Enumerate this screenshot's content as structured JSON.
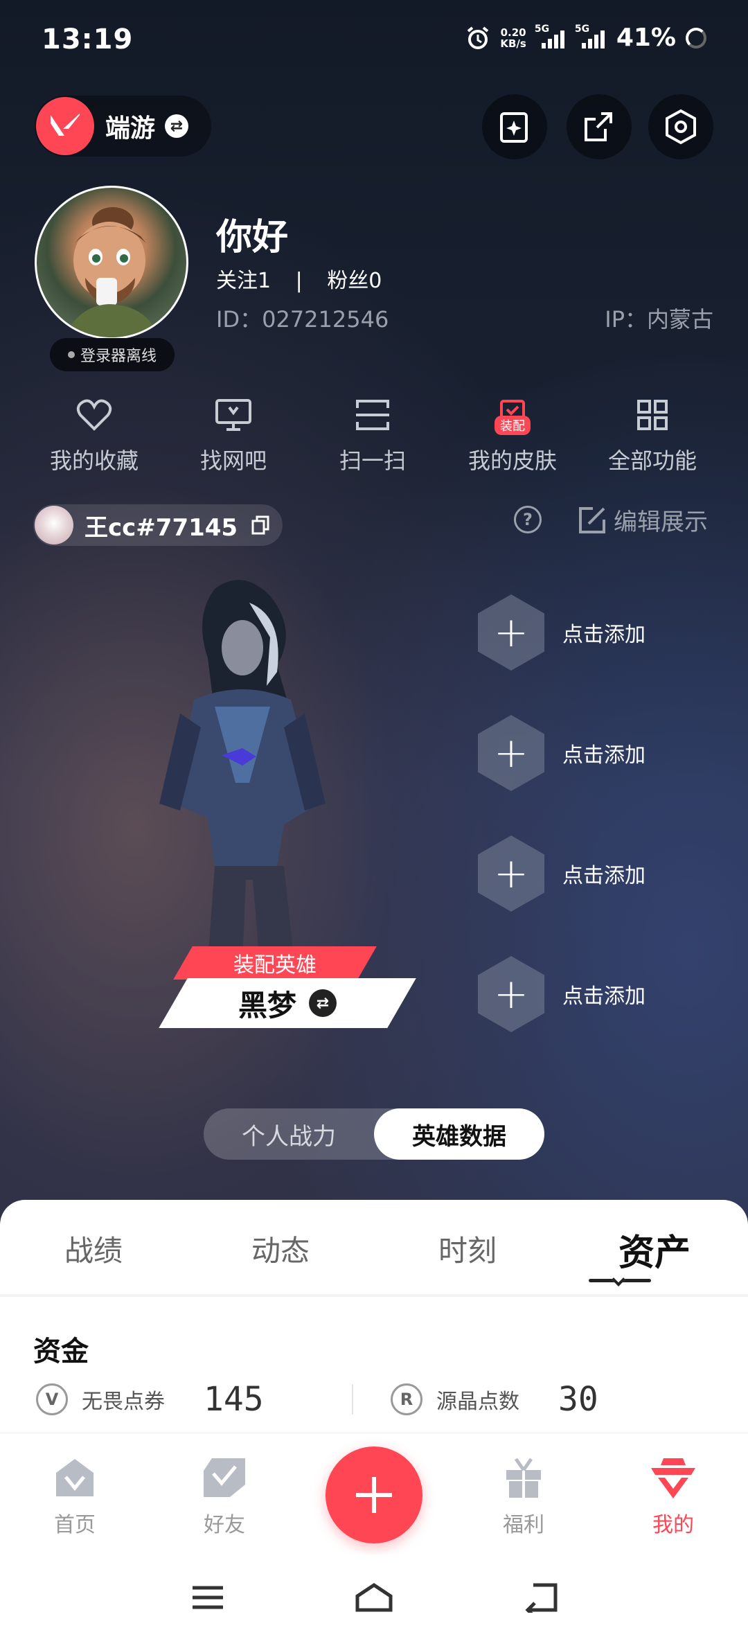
{
  "status_bar": {
    "time": "13:19",
    "net_speed_value": "0.20",
    "net_speed_unit": "KB/s",
    "sim1": "5G",
    "sim2": "5G",
    "battery": "41%"
  },
  "header": {
    "game_name": "端游",
    "icons": [
      "sparkle-card-icon",
      "share-icon",
      "settings-hexagon-icon"
    ]
  },
  "profile": {
    "name": "你好",
    "follow_text": "关注1",
    "separator": "|",
    "fans_text": "粉丝0",
    "id_text": "ID：027212546",
    "ip_text": "IP：内蒙古",
    "launcher_status": "登录器离线"
  },
  "quick_actions": [
    {
      "label": "我的收藏",
      "icon": "heart-icon"
    },
    {
      "label": "找网吧",
      "icon": "monitor-icon"
    },
    {
      "label": "扫一扫",
      "icon": "scan-icon"
    },
    {
      "label": "我的皮肤",
      "icon": "skin-icon",
      "badge": "装配"
    },
    {
      "label": "全部功能",
      "icon": "grid-icon"
    }
  ],
  "player_tag": {
    "name": "王cc#77145"
  },
  "edit_display": "编辑展示",
  "hero": {
    "equip_label": "装配英雄",
    "name": "黑梦",
    "slot_label": "点击添加"
  },
  "segment": {
    "options": [
      "个人战力",
      "英雄数据"
    ],
    "selected": "英雄数据"
  },
  "tabs": [
    {
      "label": "战绩"
    },
    {
      "label": "动态"
    },
    {
      "label": "时刻"
    },
    {
      "label": "资产"
    }
  ],
  "active_tab": "资产",
  "funds": {
    "title": "资金",
    "items": [
      {
        "label": "无畏点券",
        "value": "145",
        "icon": "v-coin-icon"
      },
      {
        "label": "源晶点数",
        "value": "30",
        "icon": "r-coin-icon"
      }
    ]
  },
  "bottom_nav": [
    {
      "label": "首页",
      "icon": "home-icon"
    },
    {
      "label": "好友",
      "icon": "friends-icon"
    },
    {
      "label": "",
      "icon": "plus-icon"
    },
    {
      "label": "福利",
      "icon": "gift-icon"
    },
    {
      "label": "我的",
      "icon": "me-icon"
    }
  ],
  "active_nav": "我的",
  "colors": {
    "accent": "#ff4655",
    "bg_dark": "#121722",
    "text_muted": "#9aa1ad"
  }
}
